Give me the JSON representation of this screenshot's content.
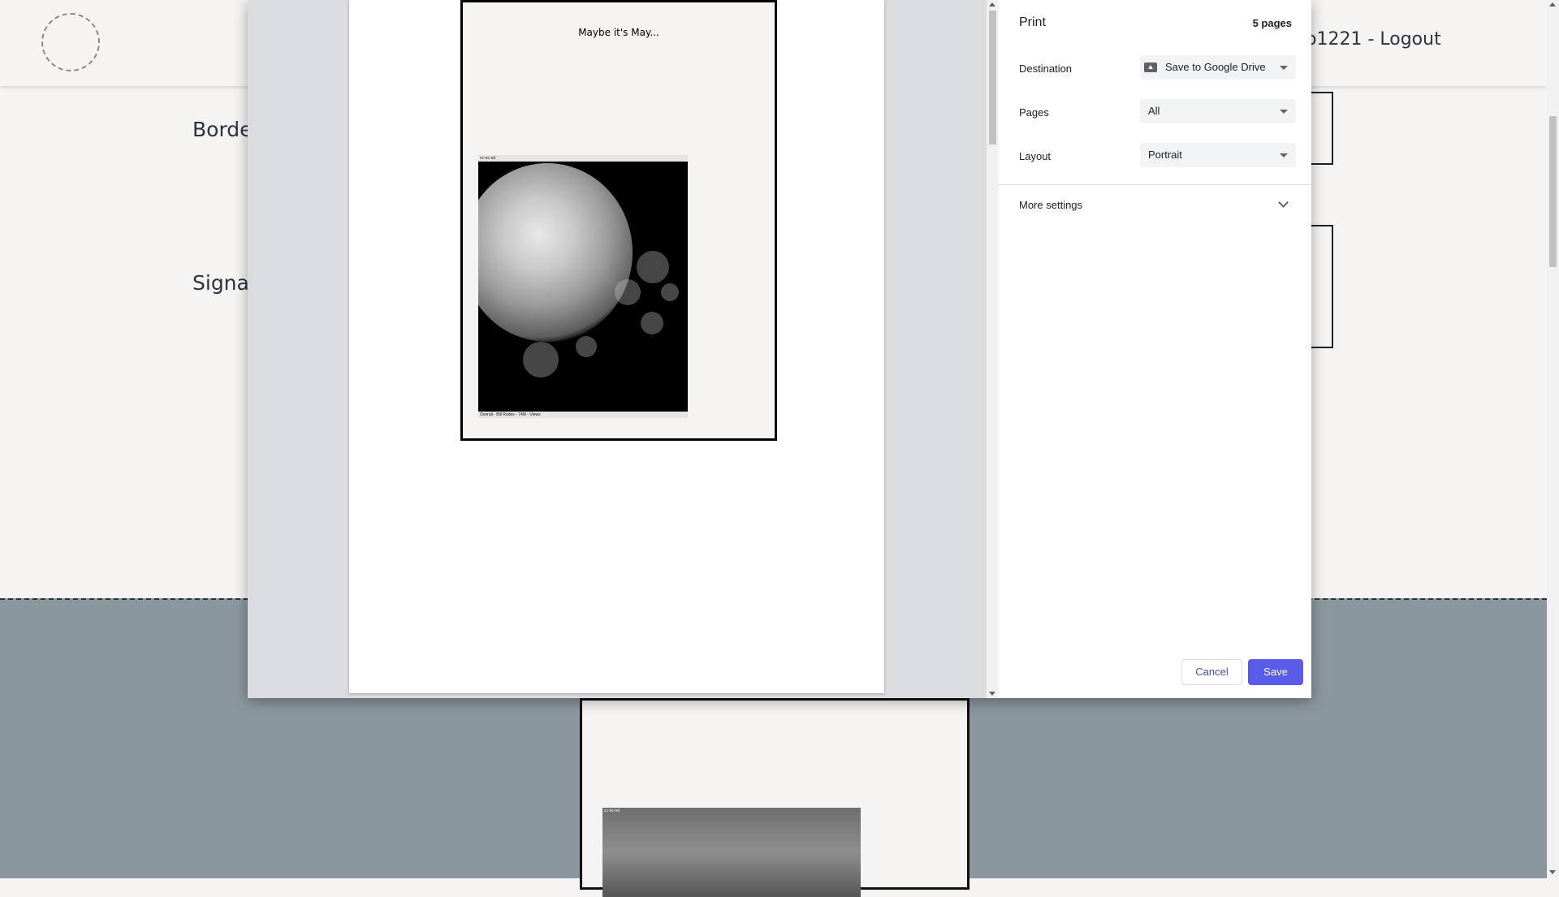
{
  "background": {
    "user_text": "o1221 - Logout",
    "labels": [
      "Borde",
      "Signat"
    ],
    "card_photo_tag": "cc-nc-nd"
  },
  "dialog": {
    "title": "Print",
    "page_count": "5 pages",
    "destination": {
      "label": "Destination",
      "value": "Save to Google Drive",
      "icon": "drive-folder-icon"
    },
    "pages": {
      "label": "Pages",
      "value": "All"
    },
    "layout": {
      "label": "Layout",
      "value": "Portrait"
    },
    "more_settings": "More settings",
    "cancel": "Cancel",
    "save": "Save",
    "colors": {
      "accent": "#5b5bea",
      "cancel_text": "#3f51b5"
    }
  },
  "preview": {
    "card_title": "Maybe it's May...",
    "photo_top_tag": "cc-nc-nd",
    "photo_caption": "Overall - Bill Rodes - 74M - Views"
  }
}
